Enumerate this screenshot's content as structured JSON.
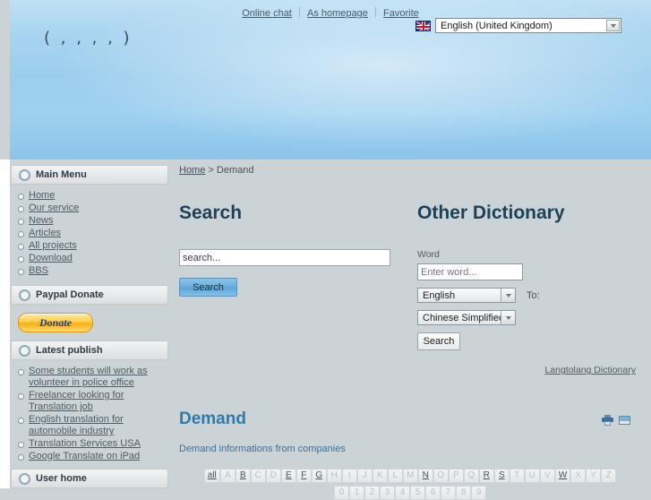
{
  "header": {
    "logo_text": "( , , , ,  )",
    "top_links": [
      "Online chat",
      "As homepage",
      "Favorite"
    ],
    "language": {
      "flag_icon": "uk-flag-icon",
      "selected": "English (United Kingdom)"
    }
  },
  "sidebar": {
    "main_menu": {
      "title": "Main Menu",
      "items": [
        "Home",
        "Our service",
        "News",
        "Articles",
        "All projects",
        "Download",
        "BBS"
      ]
    },
    "paypal": {
      "title": "Paypal Donate",
      "button_label": "Donate"
    },
    "latest": {
      "title": "Latest publish",
      "items": [
        "Some students will work as volunteer in police office",
        "Freelancer looking for Translation job",
        "English translation for automobile industry",
        "Translation Services USA",
        "Google Translate on iPad"
      ]
    },
    "user_home": {
      "title": "User home"
    }
  },
  "content": {
    "breadcrumb": {
      "home": "Home",
      "separator": ">",
      "current": "Demand"
    },
    "search": {
      "title": "Search",
      "input_value": "search...",
      "button_label": "Search"
    },
    "dictionary": {
      "title": "Other Dictionary",
      "word_label": "Word",
      "word_placeholder": "Enter word...",
      "from_language": "English",
      "to_label": "To:",
      "to_language": "Chinese Simplified",
      "button_label": "Search",
      "link_label": "Langtolang Dictionary"
    },
    "demand": {
      "title": "Demand",
      "subtitle": "Demand informations from companies",
      "print_icon": "print-icon",
      "mail_icon": "mail-icon"
    },
    "pager": {
      "all_label": "all",
      "letters": [
        "A",
        "B",
        "C",
        "D",
        "E",
        "F",
        "G",
        "H",
        "I",
        "J",
        "K",
        "L",
        "M",
        "N",
        "O",
        "P",
        "Q",
        "R",
        "S",
        "T",
        "U",
        "V",
        "W",
        "X",
        "Y",
        "Z"
      ],
      "active_letters": [
        "B",
        "E",
        "F",
        "G",
        "N",
        "R",
        "S",
        "W"
      ],
      "digits": [
        "0",
        "1",
        "2",
        "3",
        "4",
        "5",
        "6",
        "7",
        "8",
        "9"
      ],
      "active_digits": []
    }
  }
}
